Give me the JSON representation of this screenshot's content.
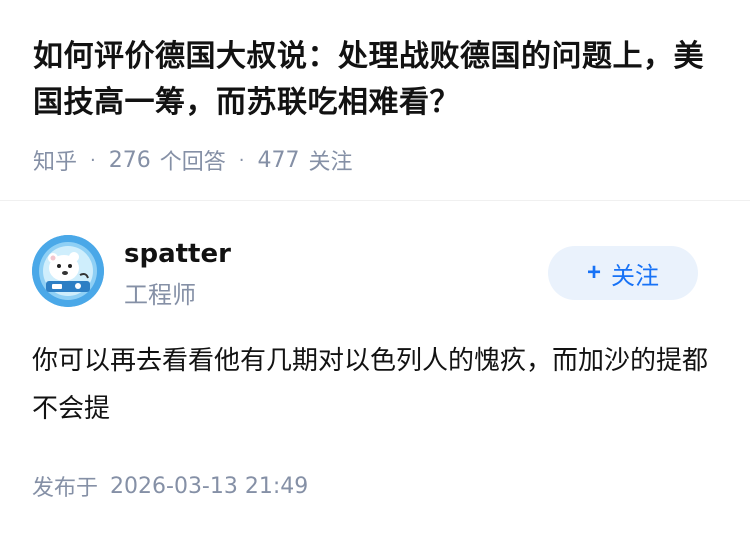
{
  "question": {
    "title": "如何评价德国大叔说：处理战败德国的问题上，美国技高一筹，而苏联吃相难看？",
    "source": "知乎",
    "separator": "·",
    "answers_count": "276",
    "answers_label": "个回答",
    "followers_count": "477",
    "followers_label": "关注"
  },
  "answer": {
    "author": {
      "name": "spatter",
      "title": "工程师",
      "avatar_icon": "polar-bear-astronaut-avatar"
    },
    "follow_button": {
      "icon": "plus-icon",
      "icon_glyph": "+",
      "label": "关注"
    },
    "content": "你可以再去看看他有几期对以色列人的愧疚，而加沙的提都不会提",
    "published_label": "发布于",
    "published_time": "2026-03-13 21:49"
  },
  "colors": {
    "accent": "#1772f6",
    "follow_bg": "#eaf2fc",
    "meta_text": "#8590a6",
    "body_text": "#121212",
    "avatar_bg": "#4aa8e8"
  }
}
